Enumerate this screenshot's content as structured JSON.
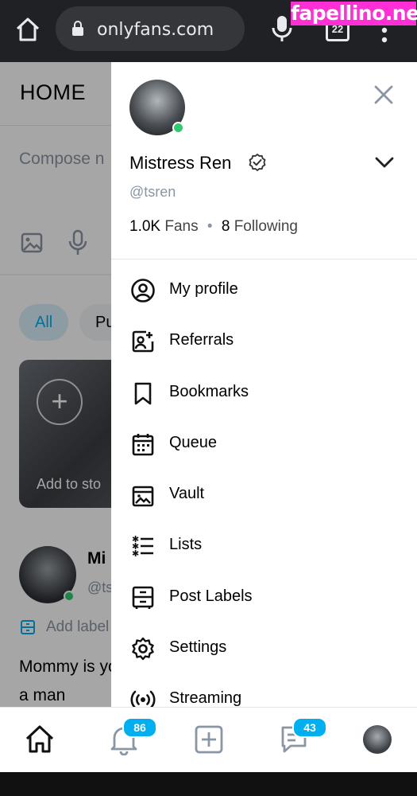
{
  "browser": {
    "url": "onlyfans.com",
    "tab_count": "22",
    "watermark": "fapellino.net"
  },
  "page": {
    "header_title": "HOME",
    "compose_placeholder": "Compose n",
    "filter_all": "All",
    "filter_partial": "Pu",
    "story_add_label": "Add to sto",
    "post_author_partial": "Mi",
    "post_handle_partial": "@ts",
    "add_label_text": "Add label",
    "post_text": "Mommy is you a man"
  },
  "drawer": {
    "profile_name": "Mistress Ren",
    "handle": "@tsren",
    "fans_count": "1.0K",
    "fans_label": "Fans",
    "stats_sep": "•",
    "following_count": "8",
    "following_label": "Following",
    "menu": [
      {
        "label": "My profile",
        "icon": "user-circle-icon"
      },
      {
        "label": "Referrals",
        "icon": "referrals-icon"
      },
      {
        "label": "Bookmarks",
        "icon": "bookmark-icon"
      },
      {
        "label": "Queue",
        "icon": "calendar-icon"
      },
      {
        "label": "Vault",
        "icon": "vault-icon"
      },
      {
        "label": "Lists",
        "icon": "list-icon"
      },
      {
        "label": "Post Labels",
        "icon": "post-labels-icon"
      },
      {
        "label": "Settings",
        "icon": "gear-icon"
      },
      {
        "label": "Streaming",
        "icon": "streaming-icon"
      }
    ]
  },
  "bottom_nav": {
    "notifications_badge": "86",
    "messages_badge": "43"
  },
  "colors": {
    "accent": "#00aff0",
    "online": "#2ecc71",
    "watermark_bg": "#ff2fd6",
    "muted_text": "#8a96a3"
  }
}
